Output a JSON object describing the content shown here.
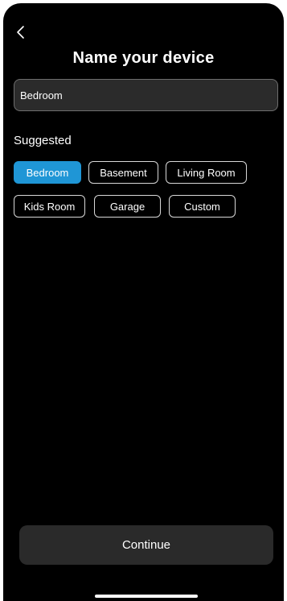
{
  "header": {
    "back_icon": "chevron-left-icon",
    "title": "Name your device"
  },
  "name_field": {
    "value": "Bedroom"
  },
  "suggestions": {
    "label": "Suggested",
    "selected": "Bedroom",
    "chips": [
      "Bedroom",
      "Basement",
      "Living Room",
      "Kids Room",
      "Garage",
      "Custom"
    ]
  },
  "footer": {
    "continue_label": "Continue"
  },
  "colors": {
    "background": "#000000",
    "accent": "#1f96d6",
    "input_background": "#2b2b2b",
    "button_background": "#2a2a2a"
  }
}
